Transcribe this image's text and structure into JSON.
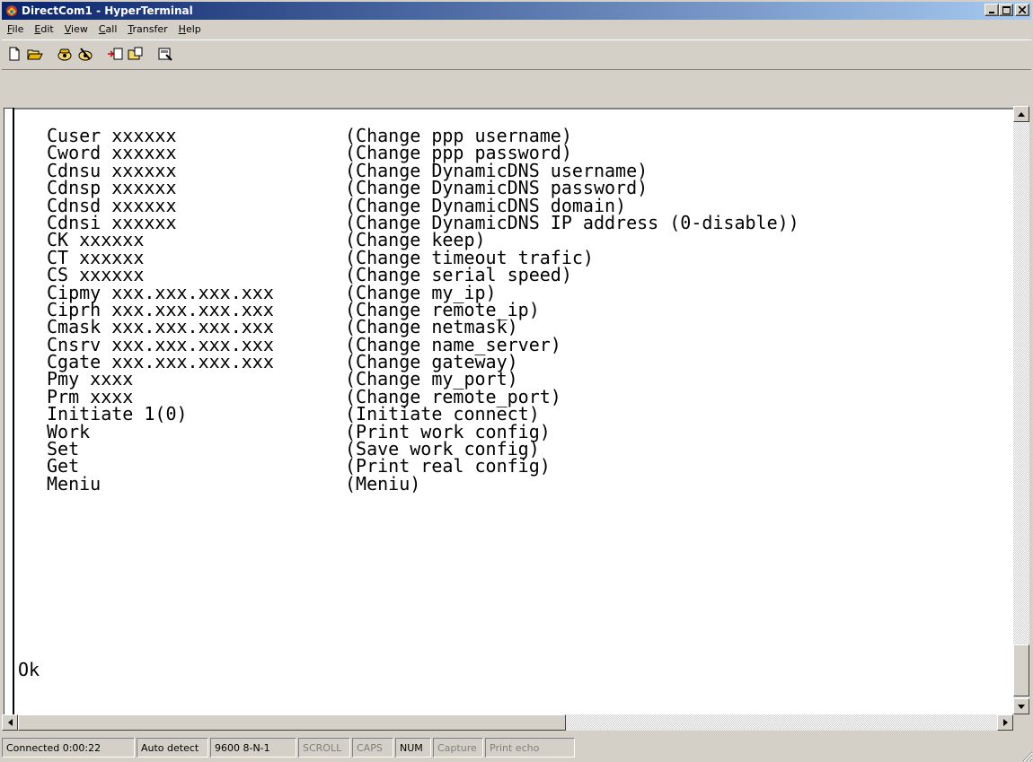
{
  "window": {
    "title": "DirectCom1 - HyperTerminal",
    "minimize": "_",
    "maximize": "□",
    "close": "×"
  },
  "menu": [
    {
      "accel": "F",
      "rest": "ile"
    },
    {
      "accel": "E",
      "rest": "dit"
    },
    {
      "accel": "V",
      "rest": "iew"
    },
    {
      "accel": "C",
      "rest": "all"
    },
    {
      "accel": "T",
      "rest": "ransfer"
    },
    {
      "accel": "H",
      "rest": "elp"
    }
  ],
  "toolbar": {
    "icons": [
      "new-icon",
      "open-icon",
      "connect-icon",
      "disconnect-icon",
      "send-icon",
      "receive-icon",
      "properties-icon"
    ]
  },
  "terminal": {
    "lines": [
      {
        "cmd": "Cuser xxxxxx",
        "desc": "(Change ppp username)"
      },
      {
        "cmd": "Cword xxxxxx",
        "desc": "(Change ppp password)"
      },
      {
        "cmd": "Cdnsu xxxxxx",
        "desc": "(Change DynamicDNS username)"
      },
      {
        "cmd": "Cdnsp xxxxxx",
        "desc": "(Change DynamicDNS password)"
      },
      {
        "cmd": "Cdnsd xxxxxx",
        "desc": "(Change DynamicDNS domain)"
      },
      {
        "cmd": "Cdnsi xxxxxx",
        "desc": "(Change DynamicDNS IP address (0-disable))"
      },
      {
        "cmd": "CK xxxxxx",
        "desc": "(Change keep)"
      },
      {
        "cmd": "CT xxxxxx",
        "desc": "(Change timeout trafic)"
      },
      {
        "cmd": "CS xxxxxx",
        "desc": "(Change serial speed)"
      },
      {
        "cmd": "Cipmy xxx.xxx.xxx.xxx",
        "desc": "(Change my_ip)"
      },
      {
        "cmd": "Ciprh xxx.xxx.xxx.xxx",
        "desc": "(Change remote_ip)"
      },
      {
        "cmd": "Cmask xxx.xxx.xxx.xxx",
        "desc": "(Change netmask)"
      },
      {
        "cmd": "Cnsrv xxx.xxx.xxx.xxx",
        "desc": "(Change name_server)"
      },
      {
        "cmd": "Cgate xxx.xxx.xxx.xxx",
        "desc": "(Change gateway)"
      },
      {
        "cmd": "Pmy xxxx",
        "desc": "(Change my_port)"
      },
      {
        "cmd": "Prm xxxx",
        "desc": "(Change remote_port)"
      },
      {
        "cmd": "Initiate 1(0)",
        "desc": "(Initiate connect)"
      },
      {
        "cmd": "Work",
        "desc": "(Print work config)"
      },
      {
        "cmd": "Set",
        "desc": "(Save work config)"
      },
      {
        "cmd": "Get",
        "desc": "(Print real config)"
      },
      {
        "cmd": "Meniu",
        "desc": "(Meniu)"
      }
    ],
    "result": "Ok"
  },
  "status": [
    {
      "text": "Connected 0:00:22",
      "active": true,
      "w": 148
    },
    {
      "text": "Auto detect",
      "active": true,
      "w": 80
    },
    {
      "text": "9600 8-N-1",
      "active": true,
      "w": 96
    },
    {
      "text": "SCROLL",
      "active": false,
      "w": 58
    },
    {
      "text": "CAPS",
      "active": false,
      "w": 46
    },
    {
      "text": "NUM",
      "active": true,
      "w": 40
    },
    {
      "text": "Capture",
      "active": false,
      "w": 56
    },
    {
      "text": "Print echo",
      "active": false,
      "w": 100
    }
  ]
}
